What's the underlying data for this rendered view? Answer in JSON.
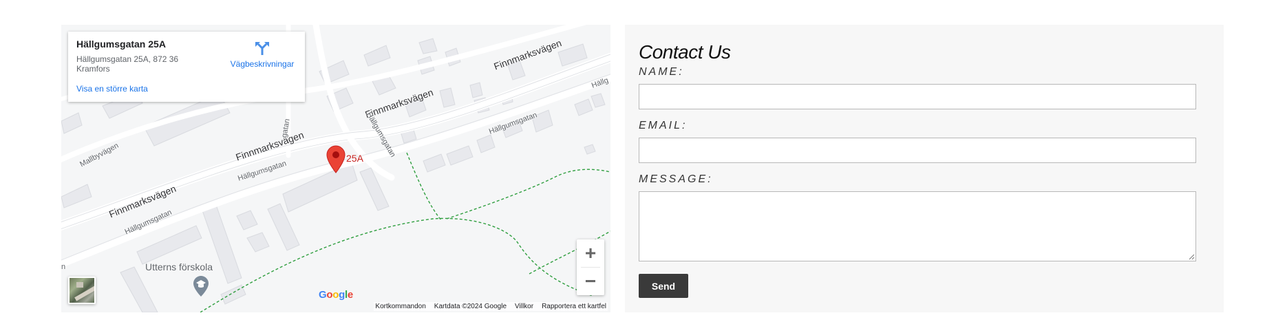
{
  "map": {
    "info_card": {
      "title": "Hällgumsgatan 25A",
      "address": "Hällgumsgatan 25A, 872 36 Kramfors",
      "larger_map_link": "Visa en större karta",
      "directions_label": "Vägbeskrivningar"
    },
    "marker_label": "25A",
    "streets": {
      "finnmarksvagen": "Finnmarksvägen",
      "hallgumsgatan": "Hällgumsgatan",
      "mallbyvagen": "Mallbyvägen",
      "gatan_partial": "gatan",
      "hallg_partial": "Hällg",
      "n_partial": "n"
    },
    "poi": {
      "name": "Utterns förskola",
      "icon": "school-icon"
    },
    "zoom": {
      "in": "+",
      "out": "−"
    },
    "logo": "Google",
    "attribution": [
      "Kortkommandon",
      "Kartdata ©2024 Google",
      "Villkor",
      "Rapportera ett kartfel"
    ],
    "colors": {
      "road": "#ffffff",
      "land": "#f5f6f7",
      "building": "#e8e9ed",
      "path": "#2e9e3e",
      "marker": "#ea4335",
      "link": "#1a73e8"
    }
  },
  "contact": {
    "title": "Contact Us",
    "name_label": "NAME:",
    "email_label": "EMAIL:",
    "message_label": "MESSAGE:",
    "name_value": "",
    "email_value": "",
    "message_value": "",
    "send_label": "Send",
    "colors": {
      "panel": "#f7f7f7",
      "button": "#3a3a3a"
    }
  }
}
